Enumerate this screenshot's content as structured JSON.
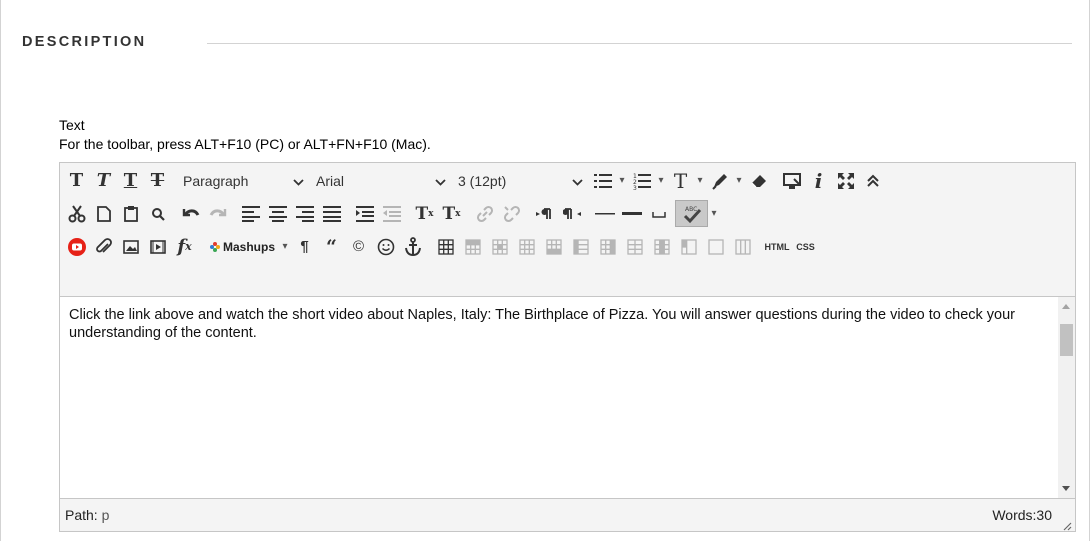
{
  "section": {
    "heading": "DESCRIPTION"
  },
  "field": {
    "label": "Text",
    "hint": "For the toolbar, press ALT+F10 (PC) or ALT+FN+F10 (Mac)."
  },
  "toolbar": {
    "format_select": "Paragraph",
    "font_select": "Arial",
    "size_select": "3 (12pt)",
    "mashups_label": "Mashups",
    "html_label": "HTML",
    "css_label": "CSS"
  },
  "editor": {
    "content": "Click the link above and watch the short video about Naples, Italy: The Birthplace of Pizza. You will answer questions during the video to check your understanding of the content."
  },
  "status": {
    "path_label": "Path:",
    "path_value": "p",
    "words": "Words:30"
  },
  "colors": {
    "youtube_red": "#e62117",
    "border": "#c6c6c6",
    "toolbar_bg": "#f4f4f4",
    "icon": "#333333",
    "icon_disabled": "#b5b5b5"
  }
}
